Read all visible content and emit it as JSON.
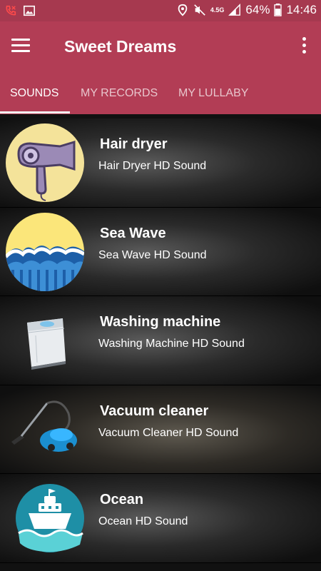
{
  "status_bar": {
    "battery": "64%",
    "time": "14:46",
    "network": "4.5G",
    "icons": [
      "phone-missed-icon",
      "image-icon",
      "location-icon",
      "mute-icon",
      "signal-icon",
      "battery-icon"
    ]
  },
  "toolbar": {
    "title": "Sweet Dreams",
    "menu_icon": "hamburger-menu-icon",
    "overflow_icon": "more-vert-icon"
  },
  "tabs": [
    {
      "label": "SOUNDS",
      "active": true
    },
    {
      "label": "MY RECORDS",
      "active": false
    },
    {
      "label": "MY LULLABY",
      "active": false
    }
  ],
  "colors": {
    "primary": "#b23d55",
    "status_bar": "#a6394f",
    "text": "#ffffff"
  },
  "sounds": [
    {
      "title": "Hair dryer",
      "subtitle": "Hair Dryer HD Sound",
      "icon": "hair-dryer-icon"
    },
    {
      "title": "Sea Wave",
      "subtitle": "Sea Wave HD Sound",
      "icon": "sea-wave-icon"
    },
    {
      "title": "Washing machine",
      "subtitle": "Washing Machine HD Sound",
      "icon": "washing-machine-icon"
    },
    {
      "title": "Vacuum cleaner",
      "subtitle": "Vacuum Cleaner HD Sound",
      "icon": "vacuum-cleaner-icon"
    },
    {
      "title": "Ocean",
      "subtitle": "Ocean HD Sound",
      "icon": "ship-icon"
    }
  ]
}
